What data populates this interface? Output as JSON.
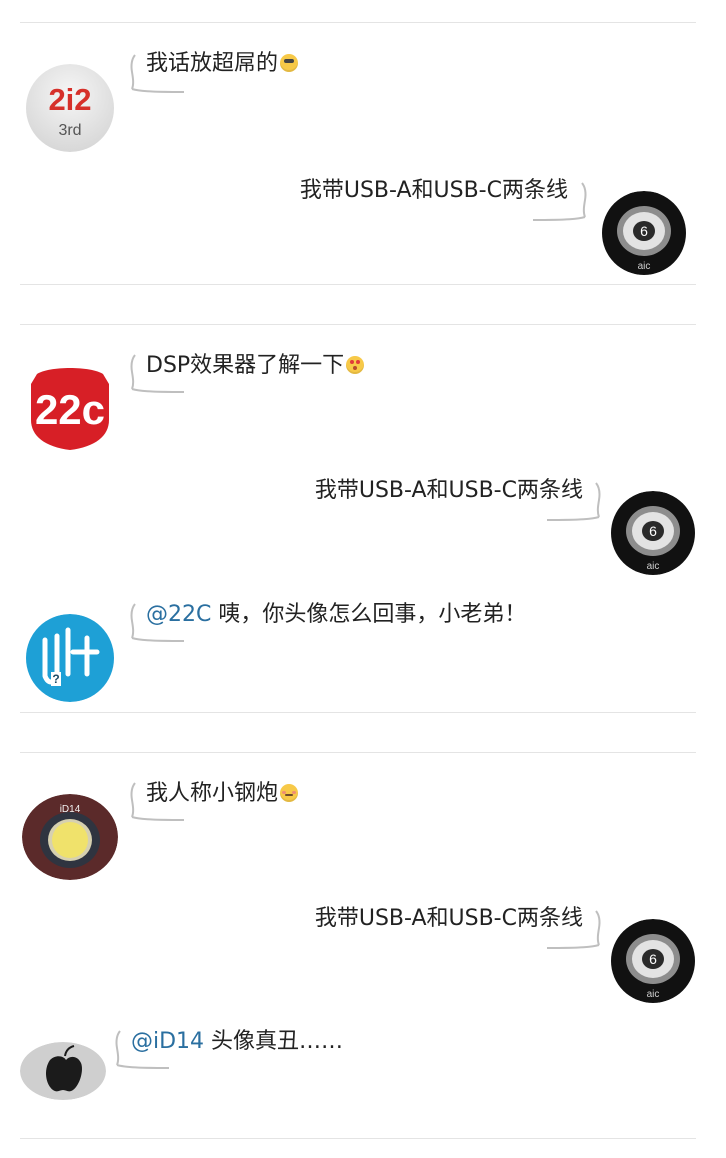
{
  "threads": [
    {
      "messages": [
        {
          "avatar": {
            "icon": "2i2-3rd-avatar-icon",
            "line1": "2i2",
            "line2": "3rd",
            "colors": {
              "bg": "#e7e7e7",
              "accent": "#d6302a"
            }
          },
          "text": "我话放超屌的",
          "emoji": "sunglasses-emoji"
        },
        {
          "avatar": {
            "icon": "black-knob-avatar-icon",
            "label": "6",
            "sub": "aic",
            "colors": {
              "bg": "#111111",
              "metal": "#9a9a9a"
            }
          },
          "text": "我带USB-A和USB-C两条线"
        }
      ]
    },
    {
      "messages": [
        {
          "avatar": {
            "icon": "22c-shield-avatar-icon",
            "label": "22c",
            "colors": {
              "bg": "#d71f26",
              "fg": "#ffffff"
            }
          },
          "text": "DSP效果器了解一下",
          "emoji": "heart-eyes-emoji"
        },
        {
          "avatar": {
            "icon": "black-knob-avatar-icon",
            "label": "6",
            "sub": "aic",
            "colors": {
              "bg": "#111111",
              "metal": "#9a9a9a"
            }
          },
          "text": "我带USB-A和USB-C两条线"
        },
        {
          "avatar": {
            "icon": "blue-circle-avatar-icon",
            "label": "?",
            "colors": {
              "bg": "#1ea0d6",
              "fg": "#ffffff"
            }
          },
          "mention": "@22C",
          "text": "咦，你头像怎么回事，小老弟！"
        }
      ]
    },
    {
      "messages": [
        {
          "avatar": {
            "icon": "id14-device-avatar-icon",
            "label": "iD14",
            "colors": {
              "bg": "#5b2a2a",
              "knob": "#f0e26b"
            }
          },
          "text": "我人称小钢炮",
          "emoji": "blush-emoji"
        },
        {
          "avatar": {
            "icon": "black-knob-avatar-icon",
            "label": "6",
            "sub": "aic",
            "colors": {
              "bg": "#111111",
              "metal": "#9a9a9a"
            }
          },
          "text": "我带USB-A和USB-C两条线"
        },
        {
          "avatar": {
            "icon": "apple-avatar-icon",
            "colors": {
              "bg": "#cfcfcf",
              "fg": "#1b1b1b"
            }
          },
          "mention": "@iD14",
          "text": "头像真丑……"
        }
      ]
    }
  ]
}
